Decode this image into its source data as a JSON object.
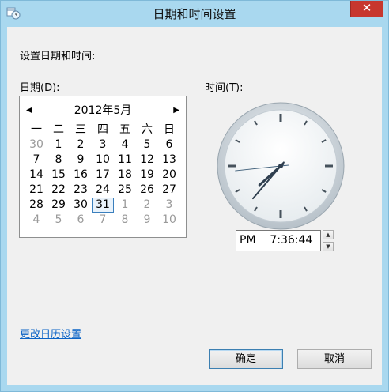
{
  "window": {
    "title": "日期和时间设置",
    "close_label": "✕"
  },
  "form": {
    "heading": "设置日期和时间:",
    "date_label_pre": "日期(",
    "date_label_key": "D",
    "date_label_post": "):",
    "time_label_pre": "时间(",
    "time_label_key": "T",
    "time_label_post": "):"
  },
  "calendar": {
    "prev_icon": "◀",
    "next_icon": "▶",
    "month_title": "2012年5月",
    "weekdays": [
      "一",
      "二",
      "三",
      "四",
      "五",
      "六",
      "日"
    ],
    "weeks": [
      [
        "30",
        "1",
        "2",
        "3",
        "4",
        "5",
        "6"
      ],
      [
        "7",
        "8",
        "9",
        "10",
        "11",
        "12",
        "13"
      ],
      [
        "14",
        "15",
        "16",
        "17",
        "18",
        "19",
        "20"
      ],
      [
        "21",
        "22",
        "23",
        "24",
        "25",
        "26",
        "27"
      ],
      [
        "28",
        "29",
        "30",
        "31",
        "1",
        "2",
        "3"
      ],
      [
        "4",
        "5",
        "6",
        "7",
        "8",
        "9",
        "10"
      ]
    ],
    "selected": "31"
  },
  "clock": {
    "hour": 7,
    "minute": 36,
    "second": 44
  },
  "time": {
    "value": "PM    7:36:44",
    "spin_up_icon": "▲",
    "spin_down_icon": "▼"
  },
  "footer": {
    "calendar_settings_link": "更改日历设置",
    "ok_label": "确定",
    "cancel_label": "取消"
  }
}
